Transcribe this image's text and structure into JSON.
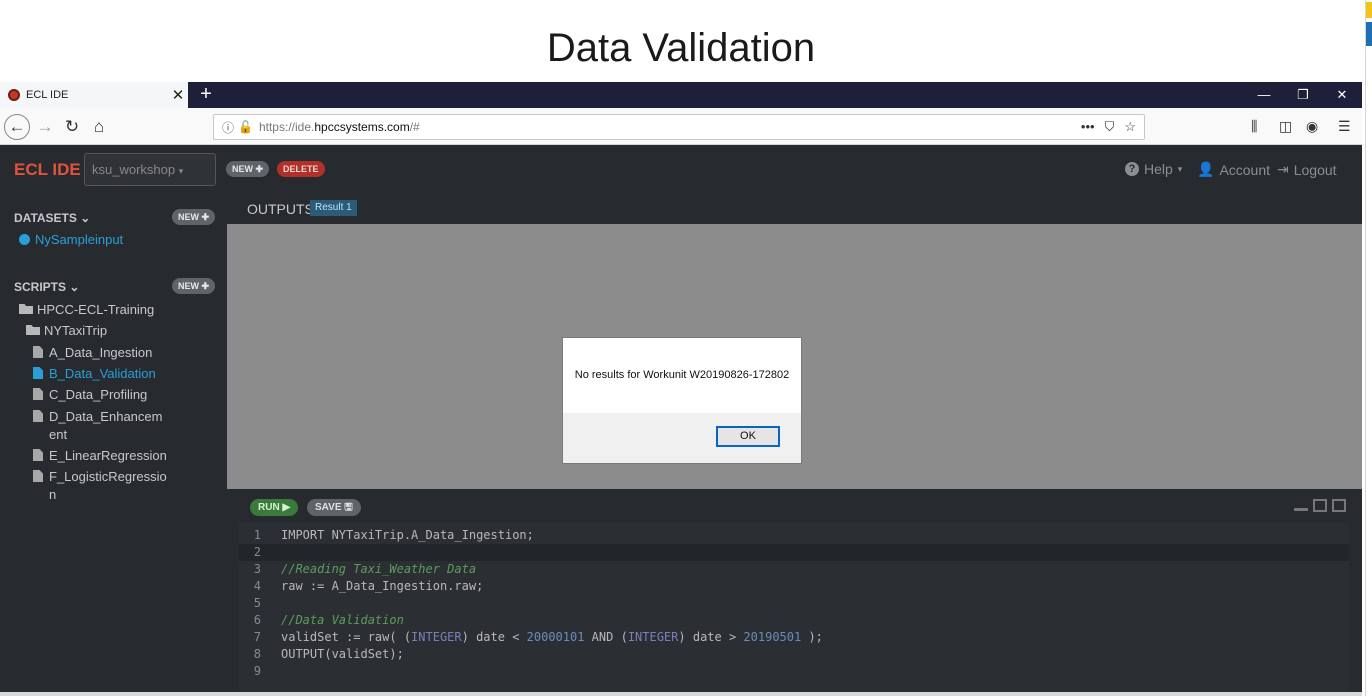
{
  "slide": {
    "title": "Data Validation"
  },
  "browser": {
    "tab_title": "ECL IDE",
    "tab_close": "✕",
    "new_tab": "+",
    "url_scheme": "https://ide.",
    "url_host": "hpccsystems.com",
    "url_path": "/#",
    "minimize": "—",
    "restore": "❐",
    "close": "✕",
    "url_more": "•••"
  },
  "app": {
    "brand": "ECL IDE",
    "workspace": "ksu_workshop",
    "new_label": "NEW",
    "delete_label": "DELETE",
    "help_label": "Help",
    "account_label": "Account",
    "logout_label": "Logout"
  },
  "sidebar": {
    "datasets_heading": "DATASETS",
    "datasets_new": "NEW",
    "datasets": [
      "NySampleinput"
    ],
    "scripts_heading": "SCRIPTS",
    "scripts_new": "NEW",
    "root_folder": "HPCC-ECL-Training",
    "sub_folder": "NYTaxiTrip",
    "files": [
      {
        "line1": "A_Data_Ingestion",
        "line2": ""
      },
      {
        "line1": "B_Data_Validation",
        "line2": ""
      },
      {
        "line1": "C_Data_Profiling",
        "line2": ""
      },
      {
        "line1": "D_Data_Enhancem",
        "line2": "ent"
      },
      {
        "line1": "E_LinearRegression",
        "line2": ""
      },
      {
        "line1": "F_LogisticRegressio",
        "line2": "n"
      }
    ],
    "active_file": "B_Data_Validation"
  },
  "outputs": {
    "label": "OUTPUTS",
    "result_tab": "Result 1"
  },
  "dialog": {
    "message": "No results for Workunit W20190826-172802",
    "ok_label": "OK"
  },
  "editor": {
    "run_label": "RUN",
    "save_label": "SAVE",
    "lines": [
      {
        "n": "1",
        "text": "IMPORT NYTaxiTrip.A_Data_Ingestion;"
      },
      {
        "n": "2",
        "text": ""
      },
      {
        "n": "3",
        "text": "//Reading Taxi_Weather Data"
      },
      {
        "n": "4",
        "text": "raw := A_Data_Ingestion.raw;"
      },
      {
        "n": "5",
        "text": ""
      },
      {
        "n": "6",
        "text": "//Data Validation"
      },
      {
        "n": "7",
        "text": "validSet := raw( (INTEGER) date < 20000101 AND (INTEGER) date > 20190501 );"
      },
      {
        "n": "8",
        "text": "OUTPUT(validSet);"
      },
      {
        "n": "9",
        "text": ""
      }
    ],
    "line7_parts": {
      "a": "validSet := raw( (",
      "b": "INTEGER",
      "c": ") date < ",
      "d": "20000101",
      "e": " AND (",
      "f": "INTEGER",
      "g": ") date > ",
      "h": "20190501",
      "i": " );"
    }
  },
  "colors": {
    "brand": "#e2533d",
    "accent": "#2a9fd6",
    "app_bg": "#272b30",
    "outputs_bg": "#8c8c8c",
    "run_green": "#3a7a3a",
    "delete_red": "#b0302a"
  }
}
